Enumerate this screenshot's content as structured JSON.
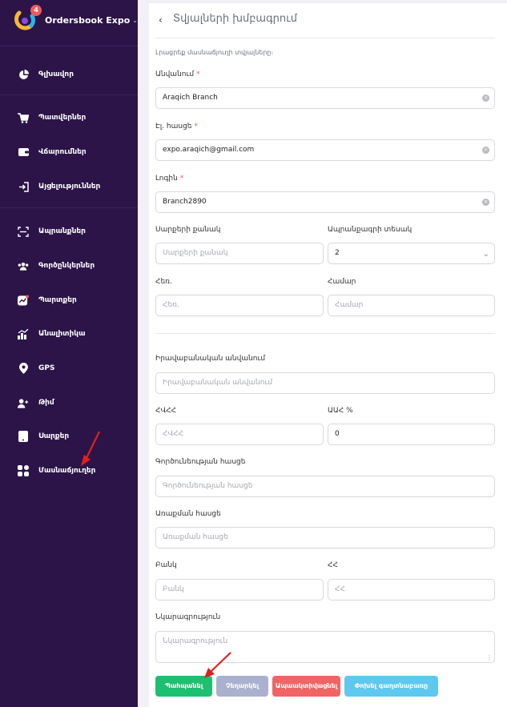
{
  "sidebar": {
    "brand": "Ordersbook Expo",
    "badge": "4",
    "items": [
      {
        "label": "Գլխավոր",
        "icon": "pie-chart-icon"
      },
      {
        "label": "Պատվերներ",
        "icon": "cart-icon"
      },
      {
        "label": "Վճարումներ",
        "icon": "wallet-icon"
      },
      {
        "label": "Այցելություններ",
        "icon": "login-icon"
      },
      {
        "label": "Ապրանքներ",
        "icon": "barcode-scan-icon"
      },
      {
        "label": "Գործընկերներ",
        "icon": "users-icon"
      },
      {
        "label": "Պարտքեր",
        "icon": "trend-chart-icon"
      },
      {
        "label": "Անալիտիկա",
        "icon": "bar-chart-icon"
      },
      {
        "label": "GPS",
        "icon": "location-pin-icon"
      },
      {
        "label": "Թիմ",
        "icon": "team-icon"
      },
      {
        "label": "Սարքեր",
        "icon": "device-icon"
      },
      {
        "label": "Մասնաճյուղեր",
        "icon": "grid-icon"
      }
    ]
  },
  "header": {
    "title": "Տվյալների խմբագրում"
  },
  "form": {
    "intro": "Լրացրեք մասնաճյուղի տվյալները։",
    "name": {
      "label": "Անվանում",
      "value": "Araqich Branch"
    },
    "email": {
      "label": "Էլ. հասցե",
      "value": "expo.araqich@gmail.com"
    },
    "login": {
      "label": "Լոգին",
      "value": "Branch2890"
    },
    "devices_count": {
      "label": "Սարքերի քանակ",
      "placeholder": "Սարքերի քանակ"
    },
    "price_list_type": {
      "label": "Ապրանքագրի տեսակ",
      "value": "2"
    },
    "phone": {
      "label": "Հեռ.",
      "placeholder": "Հեռ."
    },
    "number": {
      "label": "Համար",
      "placeholder": "Համար"
    },
    "legal_name": {
      "label": "Իրավաբանական անվանում",
      "placeholder": "Իրավաբանական անվանում"
    },
    "tin": {
      "label": "ՀՎՀՀ",
      "placeholder": "ՀՎՀՀ"
    },
    "vat": {
      "label": "ԱԱՀ %",
      "value": "0"
    },
    "activity_address": {
      "label": "Գործունեության հասցե",
      "placeholder": "Գործունեության հասցե"
    },
    "legal_address": {
      "label": "Առաքման հասցե",
      "placeholder": "Առաքման հասցե"
    },
    "bank": {
      "label": "Բանկ",
      "placeholder": "Բանկ"
    },
    "account": {
      "label": "ՀՀ",
      "placeholder": "ՀՀ"
    },
    "description": {
      "label": "Նկարագրություն",
      "placeholder": "Նկարագրություն"
    }
  },
  "buttons": {
    "save": "Պահպանել",
    "cancel": "Չեղարկել",
    "deactivate": "Ապաակտիվացնել",
    "change_password": "Փոխել գաղտնաբառը"
  },
  "colors": {
    "sidebar_bg": "#2c1449",
    "save": "#1fbf72",
    "cancel": "#a9b1cf",
    "deactivate": "#ef6566",
    "change_password": "#5ec8ee",
    "annotation_arrow": "#e02020"
  }
}
